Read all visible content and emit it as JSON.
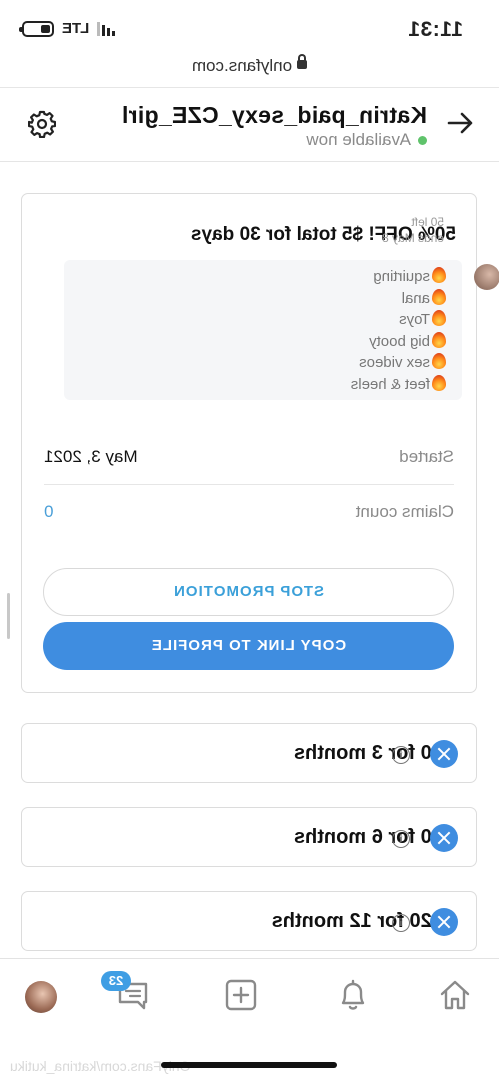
{
  "status_bar": {
    "time": "11:31",
    "network": "LTE"
  },
  "url_bar": {
    "domain": "onlyfans.com"
  },
  "header": {
    "name": "Katrin_paid_sexy_CZE_girl",
    "status": "Available now"
  },
  "promotion": {
    "title": "50% OFF! $5 total for 30 days",
    "left": "50 left",
    "ends": "ends May 8",
    "tags": [
      "squirting",
      "anal",
      "Toys",
      "big booty",
      "sex videos",
      "feet & heels"
    ],
    "started_label": "Started",
    "started_value": "May 3, 2021",
    "claims_label": "Claims count",
    "claims_value": "0",
    "stop_label": "STOP PROMOTION",
    "copy_label": "COPY LINK TO PROFILE"
  },
  "bundles": [
    {
      "label": "$30 for 3 months"
    },
    {
      "label": "$60 for 6 months"
    },
    {
      "label": "$120 for 12 months"
    }
  ],
  "bottom_nav": {
    "messages_badge": "23"
  },
  "footer": {
    "watermark": "OnlyFans.com/katrina_kutiku"
  },
  "colors": {
    "accent": "#3f8de0",
    "link": "#3ba0d9",
    "online": "#5fc36b"
  },
  "icons": [
    "back-arrow-icon",
    "gear-icon",
    "fire-icon",
    "info-icon",
    "close-icon",
    "home-icon",
    "bell-icon",
    "add-icon",
    "messages-icon",
    "lock-icon"
  ]
}
